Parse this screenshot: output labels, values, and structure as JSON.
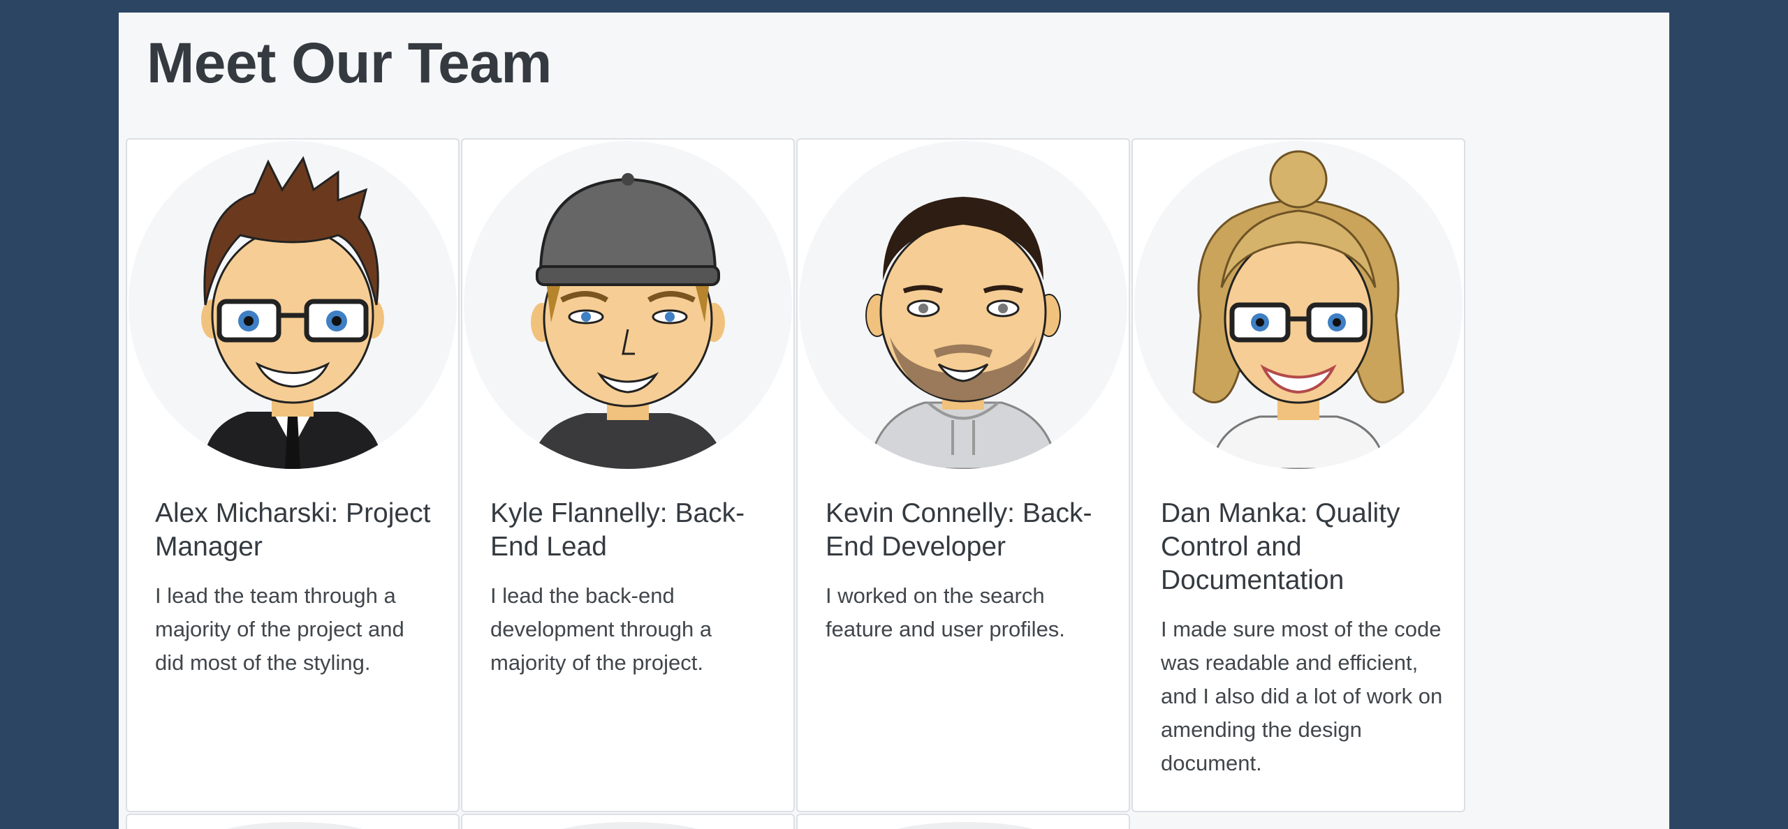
{
  "page": {
    "title": "Meet Our Team"
  },
  "team": [
    {
      "avatar_icon": "bitmoji-man-suit-glasses-icon",
      "title": "Alex Micharski: Project Manager",
      "text": "I lead the team through a majority of the project and did most of the styling."
    },
    {
      "avatar_icon": "bitmoji-man-cap-icon",
      "title": "Kyle Flannelly: Back-End Lead",
      "text": "I lead the back-end development through a majority of the project."
    },
    {
      "avatar_icon": "bitmoji-man-beard-hoodie-icon",
      "title": "Kevin Connelly: Back-End Developer",
      "text": "I worked on the search feature and user profiles."
    },
    {
      "avatar_icon": "bitmoji-woman-bun-glasses-icon",
      "title": "Dan Manka: Quality Control and Documentation",
      "text": "I made sure most of the code was readable and efficient, and I also did a lot of work on amending the design document."
    }
  ],
  "colors": {
    "background": "#2c4563",
    "page": "#f6f7f9",
    "text": "#343a40"
  }
}
